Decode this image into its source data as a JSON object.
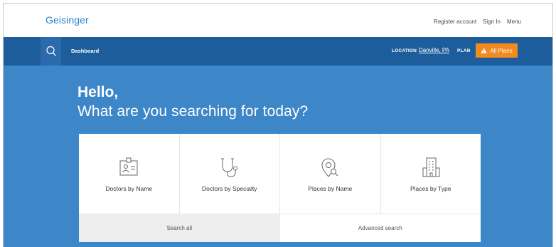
{
  "header": {
    "logo": "Geisinger",
    "links": [
      "Register account",
      "Sign In",
      "Menu"
    ]
  },
  "nav": {
    "dashboard": "Dashboard",
    "location_label": "LOCATION",
    "location_value": "Danville, PA",
    "plan_label": "PLAN",
    "plans_button": "All Plans"
  },
  "hero": {
    "greeting": "Hello,",
    "question": "What are you searching for today?"
  },
  "tiles": [
    {
      "label": "Doctors by Name",
      "icon": "id-badge-icon"
    },
    {
      "label": "Doctors by Specialty",
      "icon": "stethoscope-icon"
    },
    {
      "label": "Places by Name",
      "icon": "map-pin-search-icon"
    },
    {
      "label": "Places by Type",
      "icon": "building-icon"
    }
  ],
  "footer": {
    "search_all": "Search all",
    "advanced": "Advanced search"
  },
  "colors": {
    "brand_blue": "#2a82c7",
    "nav_blue": "#1e5d9c",
    "hero_blue": "#3d86c8",
    "accent_orange": "#f28a1f"
  }
}
